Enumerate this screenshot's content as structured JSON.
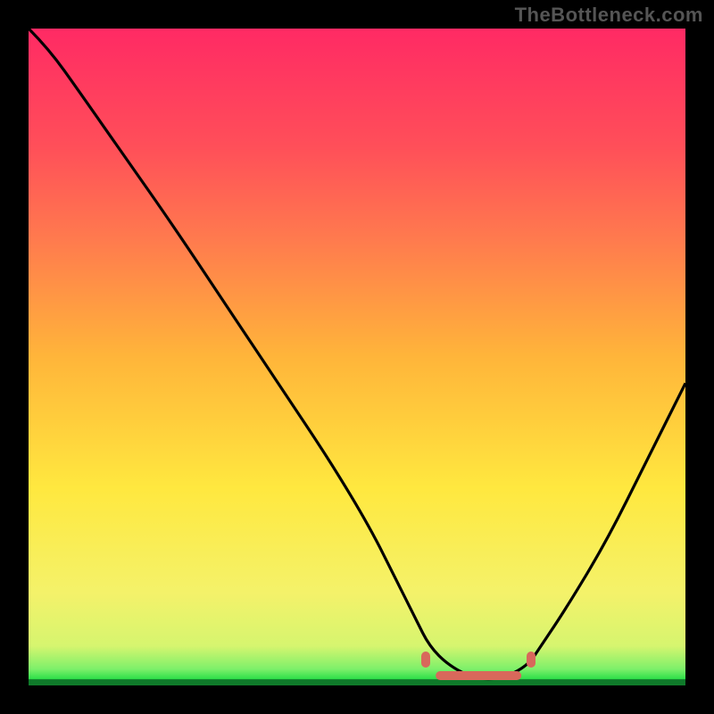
{
  "watermark": "TheBottleneck.com",
  "colors": {
    "background": "#000000",
    "curve_stroke": "#000000",
    "marker_fill": "#d8685b",
    "gradient_top": "#ff2a64",
    "gradient_bottom": "#0f7a2a"
  },
  "chart_data": {
    "type": "line",
    "title": "",
    "xlabel": "",
    "ylabel": "",
    "xlim": [
      0,
      100
    ],
    "ylim": [
      0,
      100
    ],
    "grid": false,
    "series": [
      {
        "name": "curve",
        "x": [
          0,
          3,
          8,
          15,
          22,
          30,
          38,
          46,
          52,
          56,
          59,
          61,
          64,
          68,
          72,
          76,
          78,
          82,
          88,
          94,
          100
        ],
        "values": [
          100,
          97,
          90,
          80,
          70,
          58,
          46,
          34,
          24,
          16,
          10,
          6,
          3,
          1,
          1,
          3,
          6,
          12,
          22,
          34,
          46
        ]
      }
    ],
    "markers": [
      {
        "name": "left-dot",
        "x": 60.5,
        "y": 4.0
      },
      {
        "name": "right-dot",
        "x": 76.5,
        "y": 4.0
      }
    ],
    "marker_band": {
      "x_start": 62,
      "x_end": 75,
      "y": 1.5
    },
    "annotations": []
  }
}
